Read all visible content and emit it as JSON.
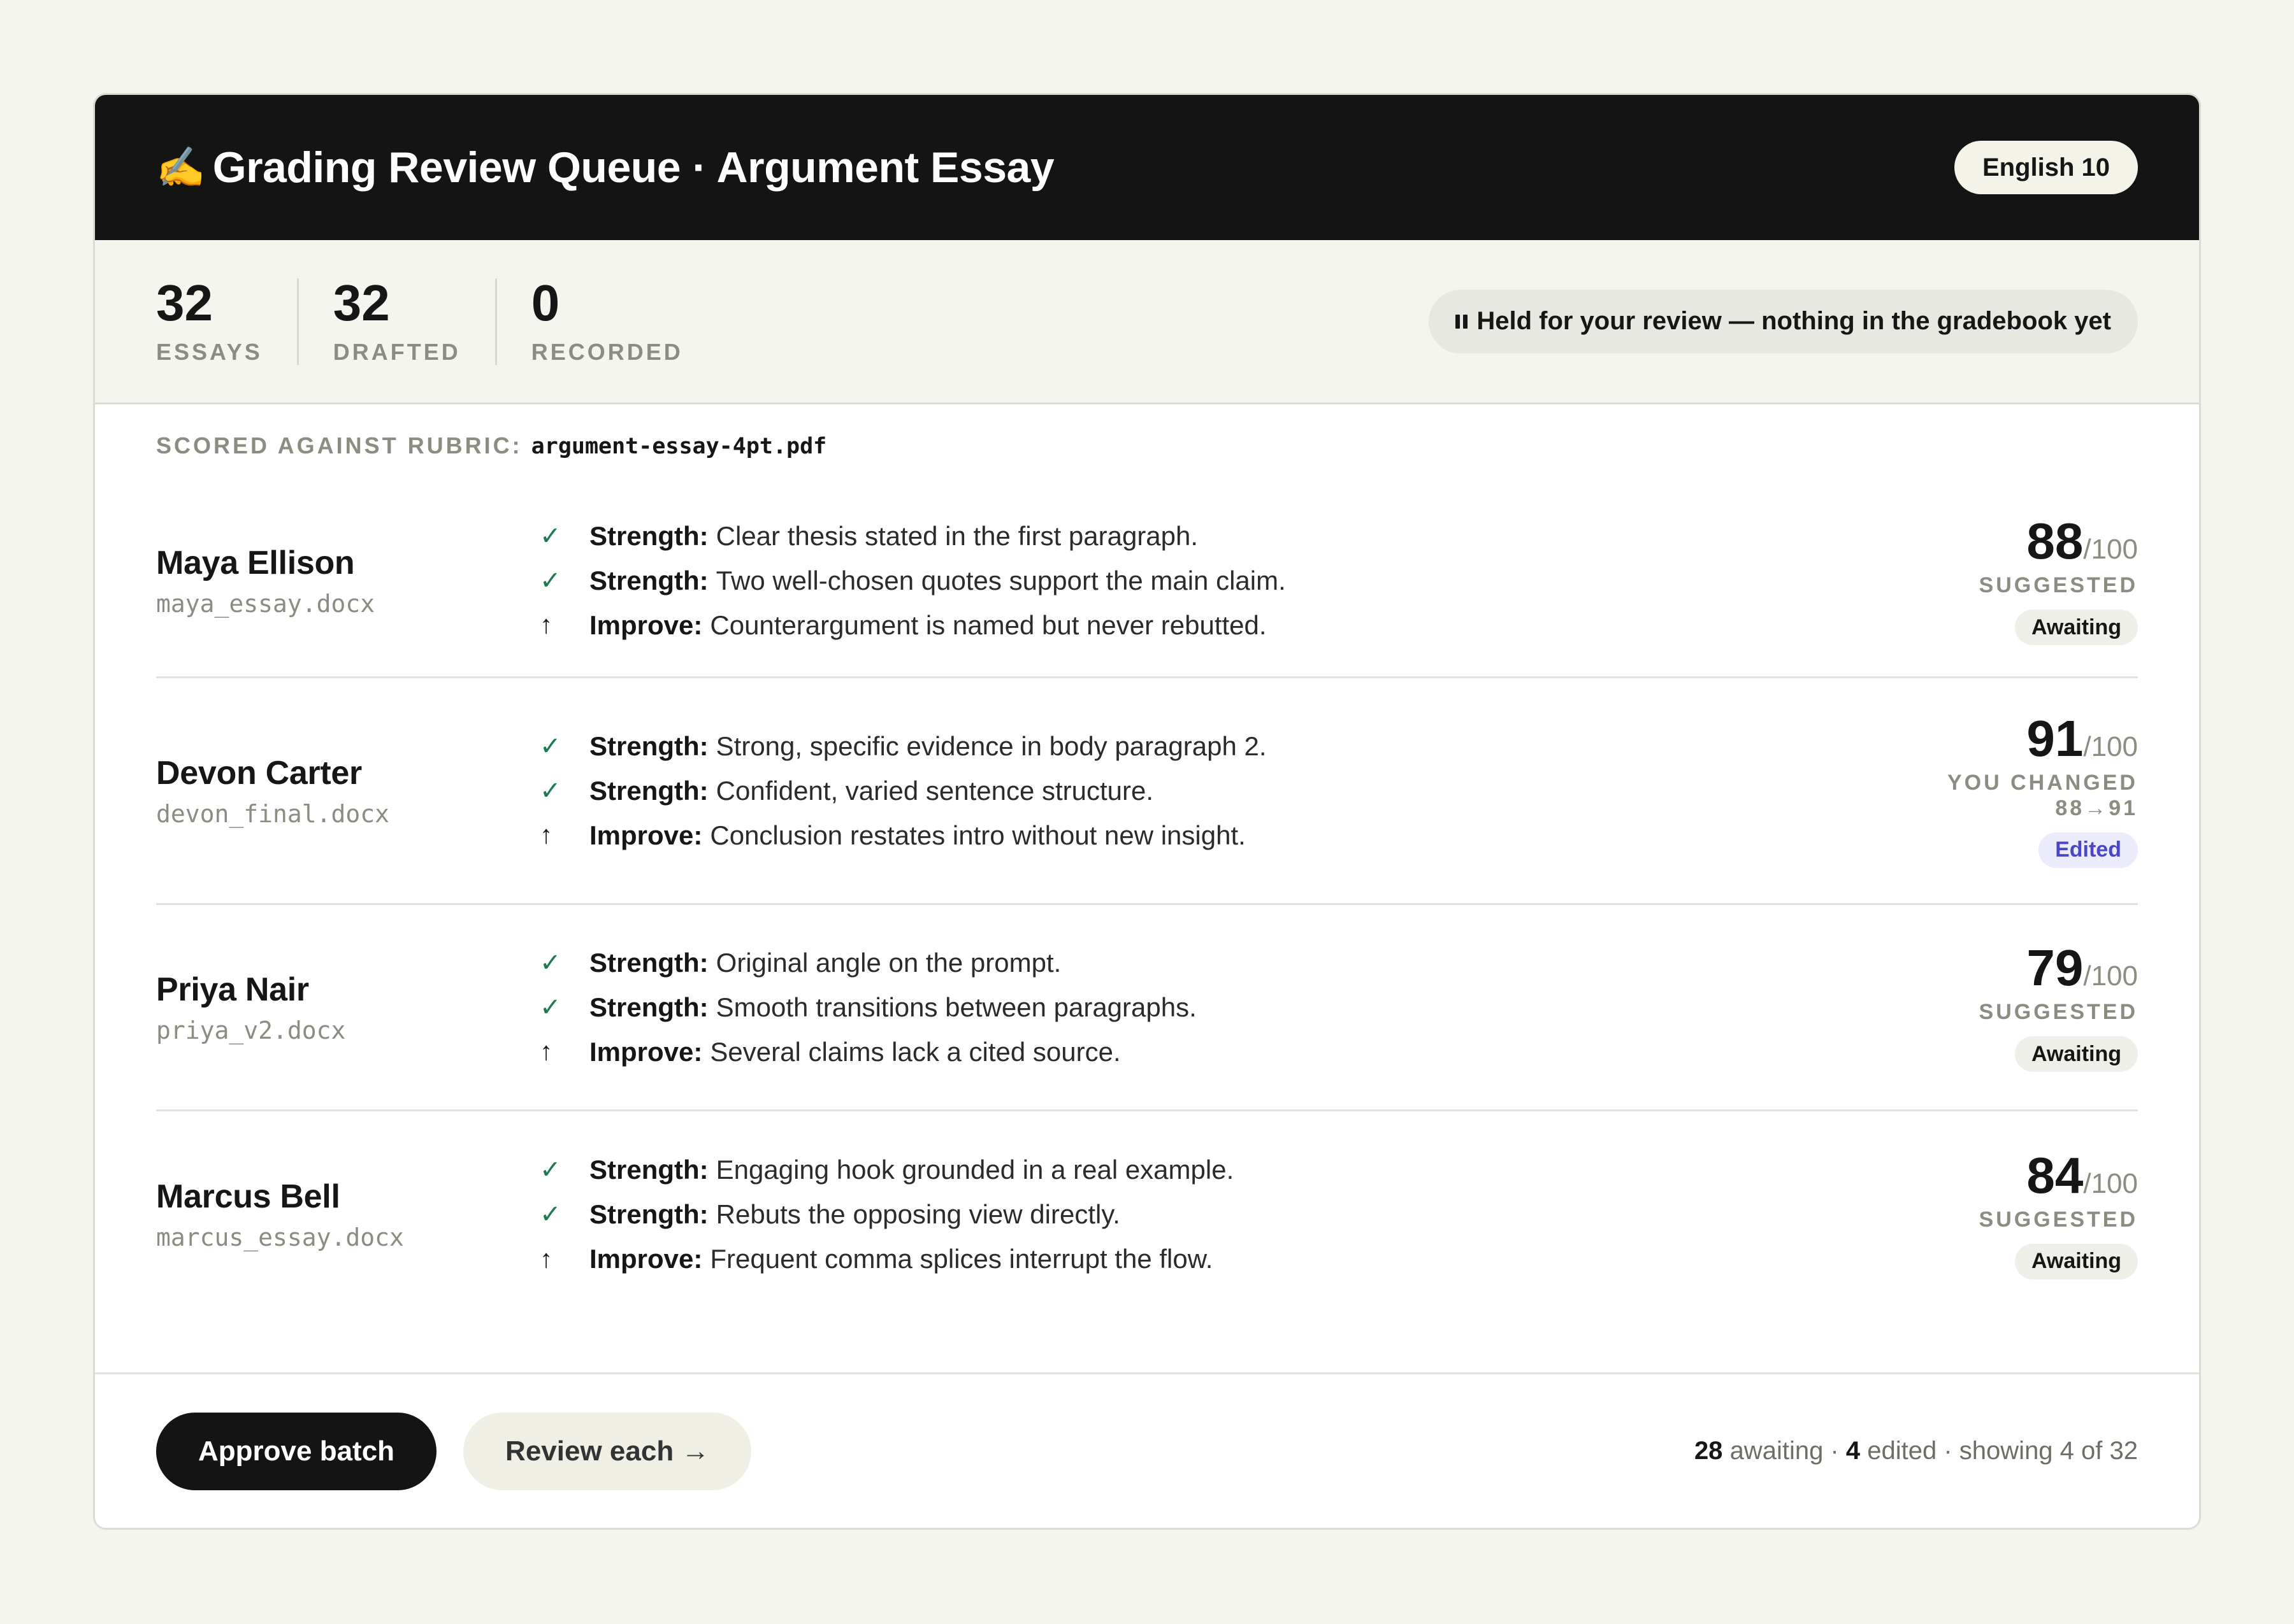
{
  "header": {
    "icon": "✍️",
    "title": "Grading Review Queue · Argument Essay",
    "class_pill": "English 10"
  },
  "stats": [
    {
      "value": "32",
      "label": "ESSAYS"
    },
    {
      "value": "32",
      "label": "DRAFTED"
    },
    {
      "value": "0",
      "label": "RECORDED"
    }
  ],
  "status": {
    "text": "Held for your review — nothing in the gradebook yet"
  },
  "rubric": {
    "label": "SCORED AGAINST RUBRIC:",
    "file": "argument-essay-4pt.pdf"
  },
  "icons": {
    "strength": "✓",
    "improve": "↑"
  },
  "students": [
    {
      "name": "Maya Ellison",
      "file": "maya_essay.docx",
      "notes": [
        {
          "kind": "Strength:",
          "text": "Clear thesis stated in the first paragraph."
        },
        {
          "kind": "Strength:",
          "text": "Two well-chosen quotes support the main claim."
        },
        {
          "kind": "Improve:",
          "text": "Counterargument is named but never rebutted."
        }
      ],
      "score": "88",
      "out_of": "/100",
      "score_label": "SUGGESTED",
      "score_sublabel": "",
      "badge": "Awaiting"
    },
    {
      "name": "Devon Carter",
      "file": "devon_final.docx",
      "notes": [
        {
          "kind": "Strength:",
          "text": "Strong, specific evidence in body paragraph 2."
        },
        {
          "kind": "Strength:",
          "text": "Confident, varied sentence structure."
        },
        {
          "kind": "Improve:",
          "text": "Conclusion restates intro without new insight."
        }
      ],
      "score": "91",
      "out_of": "/100",
      "score_label": "YOU CHANGED",
      "score_sublabel": "88→91",
      "badge": "Edited"
    },
    {
      "name": "Priya Nair",
      "file": "priya_v2.docx",
      "notes": [
        {
          "kind": "Strength:",
          "text": "Original angle on the prompt."
        },
        {
          "kind": "Strength:",
          "text": "Smooth transitions between paragraphs."
        },
        {
          "kind": "Improve:",
          "text": "Several claims lack a cited source."
        }
      ],
      "score": "79",
      "out_of": "/100",
      "score_label": "SUGGESTED",
      "score_sublabel": "",
      "badge": "Awaiting"
    },
    {
      "name": "Marcus Bell",
      "file": "marcus_essay.docx",
      "notes": [
        {
          "kind": "Strength:",
          "text": "Engaging hook grounded in a real example."
        },
        {
          "kind": "Strength:",
          "text": "Rebuts the opposing view directly."
        },
        {
          "kind": "Improve:",
          "text": "Frequent comma splices interrupt the flow."
        }
      ],
      "score": "84",
      "out_of": "/100",
      "score_label": "SUGGESTED",
      "score_sublabel": "",
      "badge": "Awaiting"
    }
  ],
  "footer": {
    "approve_label": "Approve batch",
    "review_label": "Review each →",
    "awaiting_count": "28",
    "awaiting_text": "awaiting ·",
    "edited_count": "4",
    "edited_text": "edited · showing 4 of 32"
  },
  "colors": {
    "header_bg": "#141414",
    "strength_check": "#1e7a50",
    "edited_badge": "#4a47c7",
    "page_bg": "#f5f5f0"
  }
}
